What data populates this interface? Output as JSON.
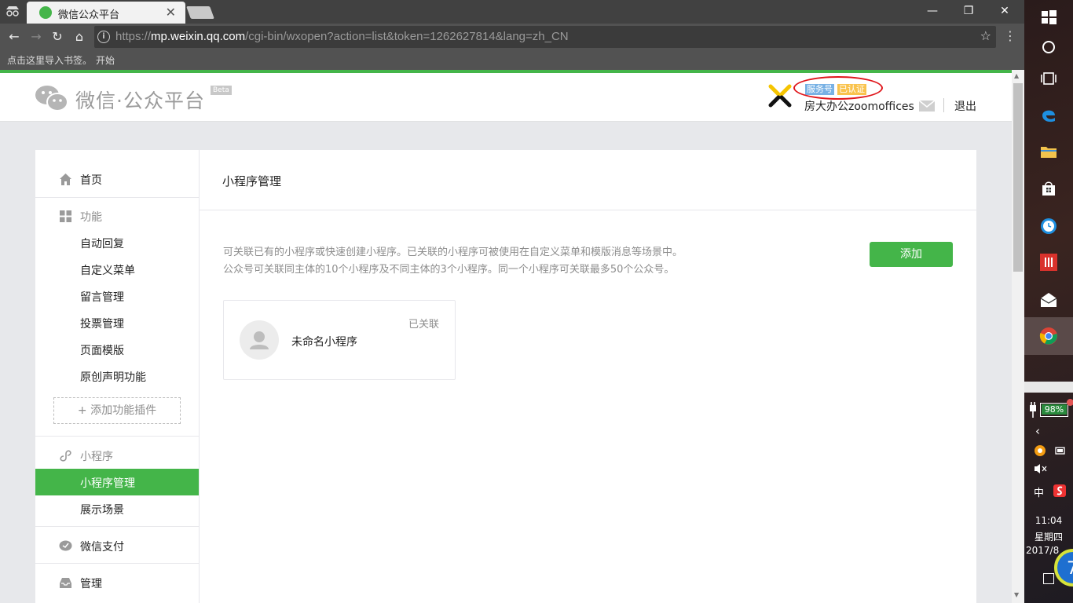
{
  "browser": {
    "tab_title": "微信公众平台",
    "url_prefix": "https://",
    "url_host": "mp.weixin.qq.com",
    "url_path": "/cgi-bin/wxopen?action=list&token=1262627814&lang=zh_CN",
    "bookmarks_hint": "点击这里导入书签。",
    "bookmarks_start": "开始"
  },
  "header": {
    "logo_text": "微信·公众平台",
    "beta": "Beta",
    "badge_service": "服务号",
    "badge_verified": "已认证",
    "account_name": "房大办公zoomoffices",
    "logout": "退出"
  },
  "sidebar": {
    "home": "首页",
    "features": "功能",
    "feature_items": [
      "自动回复",
      "自定义菜单",
      "留言管理",
      "投票管理",
      "页面模版",
      "原创声明功能"
    ],
    "add_plugin": "+ 添加功能插件",
    "miniprogram": "小程序",
    "mp_items": [
      "小程序管理",
      "展示场景"
    ],
    "wechat_pay": "微信支付",
    "manage": "管理"
  },
  "main": {
    "title": "小程序管理",
    "desc_line1": "可关联已有的小程序或快速创建小程序。已关联的小程序可被使用在自定义菜单和模版消息等场景中。",
    "desc_line2": "公众号可关联同主体的10个小程序及不同主体的3个小程序。同一个小程序可关联最多50个公众号。",
    "add_button": "添加",
    "card_name": "未命名小程序",
    "card_status": "已关联"
  },
  "taskbar": {
    "battery": "98%",
    "ime": "中",
    "time": "11:04",
    "weekday": "星期四",
    "date": "2017/8"
  }
}
